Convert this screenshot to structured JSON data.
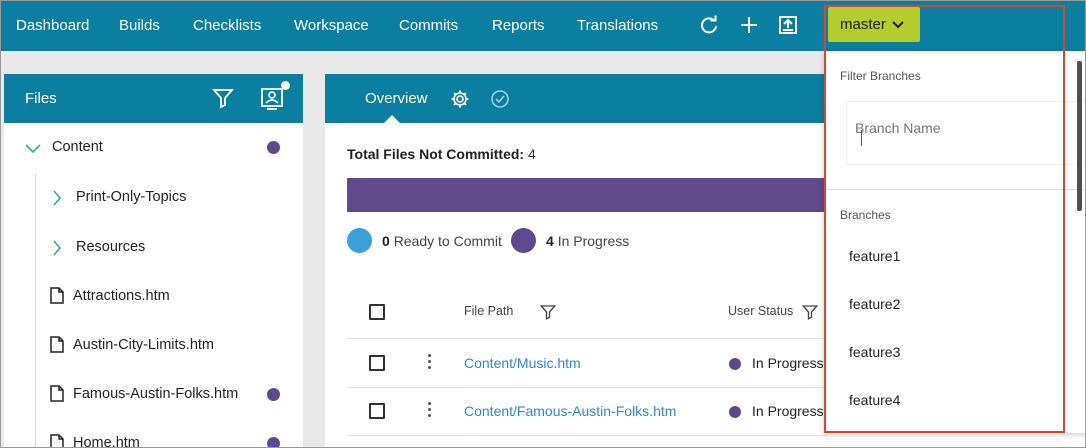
{
  "nav": {
    "items": [
      "Dashboard",
      "Builds",
      "Checklists",
      "Workspace",
      "Commits",
      "Reports",
      "Translations"
    ],
    "icons": [
      "refresh-icon",
      "plus-icon",
      "upload-icon"
    ],
    "branch": "master"
  },
  "files": {
    "title": "Files",
    "tree": [
      {
        "label": "Content",
        "type": "folder-open",
        "dot": true
      },
      {
        "label": "Print-Only-Topics",
        "type": "folder-closed",
        "dot": false
      },
      {
        "label": "Resources",
        "type": "folder-closed",
        "dot": false
      },
      {
        "label": "Attractions.htm",
        "type": "file",
        "dot": false
      },
      {
        "label": "Austin-City-Limits.htm",
        "type": "file",
        "dot": false
      },
      {
        "label": "Famous-Austin-Folks.htm",
        "type": "file",
        "dot": true
      },
      {
        "label": "Home.htm",
        "type": "file",
        "dot": true
      }
    ]
  },
  "overview": {
    "tab": "Overview",
    "summary_label": "Total Files Not Committed:",
    "summary_value": "4",
    "ready_count": "0",
    "ready_label": "Ready to Commit",
    "progress_count": "4",
    "progress_label": "In Progress",
    "columns": [
      "File Path",
      "User Status"
    ],
    "rows": [
      {
        "path": "Content/Music.htm",
        "status": "In Progress"
      },
      {
        "path": "Content/Famous-Austin-Folks.htm",
        "status": "In Progress"
      }
    ]
  },
  "dropdown": {
    "filter_label": "Filter Branches",
    "input_placeholder": "Branch Name",
    "branches_label": "Branches",
    "branches": [
      "feature1",
      "feature2",
      "feature3",
      "feature4"
    ]
  },
  "colors": {
    "header": "#0a7fa0",
    "branch_button": "#b4cd2a",
    "in_progress": "#5c4a8c",
    "ready": "#3b9fd9",
    "highlight": "#d9462f"
  }
}
